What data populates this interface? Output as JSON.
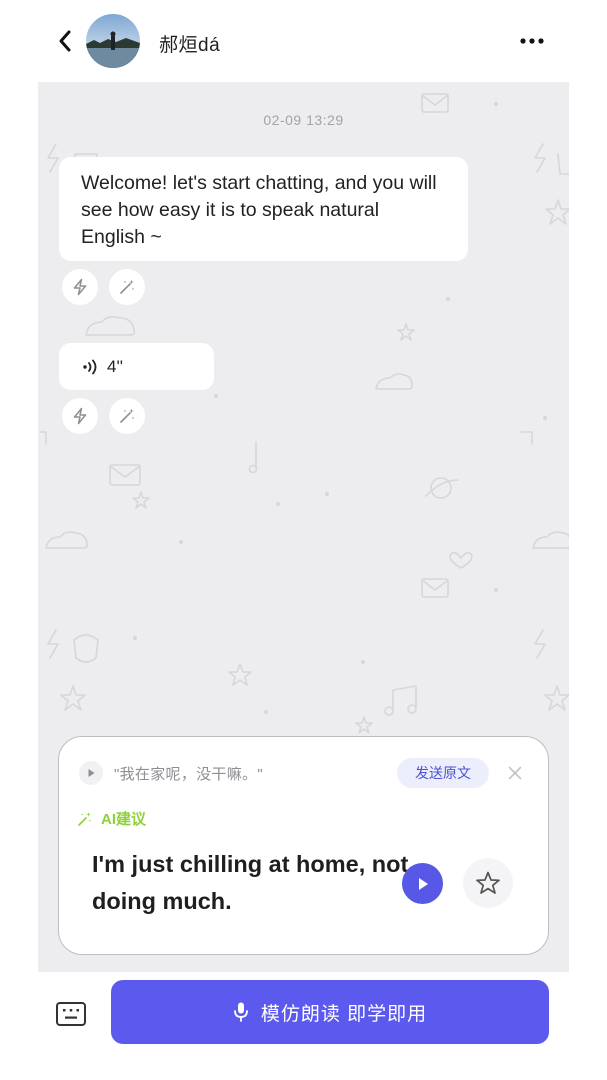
{
  "header": {
    "contact_name": "郝烜dá"
  },
  "chat": {
    "timestamp": "02-09 13:29",
    "messages": [
      {
        "type": "text",
        "text": "Welcome! let's start chatting, and you will see how easy it is to speak natural English ~"
      },
      {
        "type": "voice",
        "duration": "4''"
      }
    ]
  },
  "suggestion": {
    "original_text": "\"我在家呢，没干嘛。\"",
    "send_original_label": "发送原文",
    "ai_label": "AI建议",
    "suggested_text": "I'm just chilling at home, not doing much."
  },
  "bottom": {
    "record_label": "模仿朗读 即学即用"
  },
  "colors": {
    "accent": "#5b59ee",
    "ai_green": "#8fd13c",
    "chat_background": "#ededf0"
  }
}
